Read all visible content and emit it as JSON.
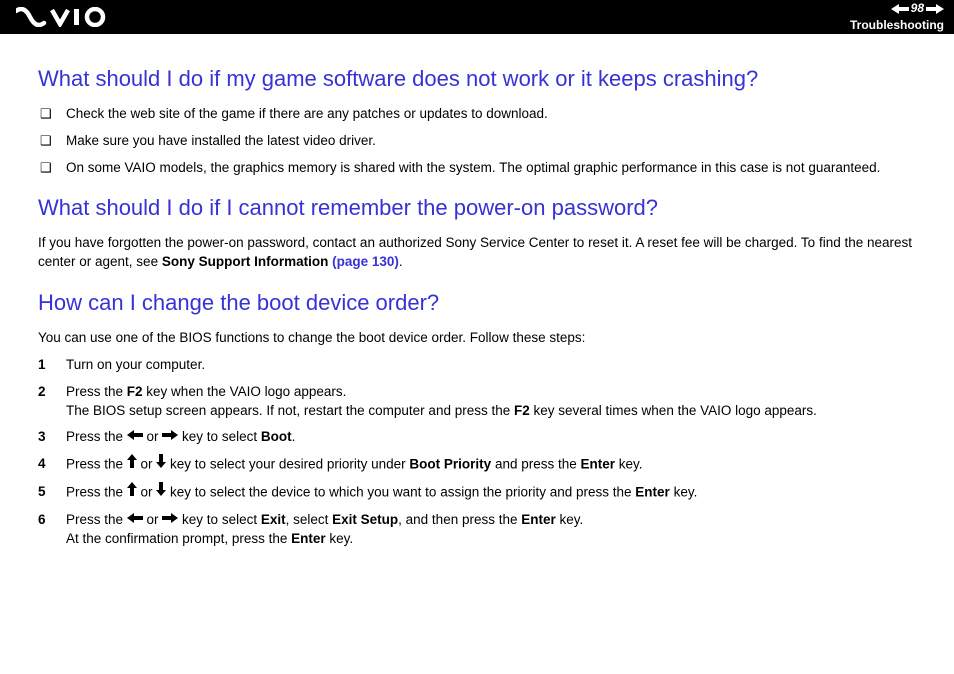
{
  "header": {
    "page_number": "98",
    "section": "Troubleshooting"
  },
  "q1": {
    "title": "What should I do if my game software does not work or it keeps crashing?",
    "bullets": [
      "Check the web site of the game if there are any patches or updates to download.",
      "Make sure you have installed the latest video driver.",
      "On some VAIO models, the graphics memory is shared with the system. The optimal graphic performance in this case is not guaranteed."
    ]
  },
  "q2": {
    "title": "What should I do if I cannot remember the power-on password?",
    "body_pre": "If you have forgotten the power-on password, contact an authorized Sony Service Center to reset it. A reset fee will be charged. To find the nearest center or agent, see ",
    "body_bold": "Sony Support Information ",
    "body_link": "(page 130)",
    "body_post": "."
  },
  "q3": {
    "title": "How can I change the boot device order?",
    "intro": "You can use one of the BIOS functions to change the boot device order. Follow these steps:",
    "steps": {
      "s1": {
        "num": "1",
        "text": "Turn on your computer."
      },
      "s2": {
        "num": "2",
        "pre": "Press the ",
        "key": "F2",
        "mid": " key when the VAIO logo appears.",
        "line2_pre": "The BIOS setup screen appears. If not, restart the computer and press the ",
        "line2_key": "F2",
        "line2_post": " key several times when the VAIO logo appears."
      },
      "s3": {
        "num": "3",
        "pre": "Press the ",
        "or": " or ",
        "mid": " key to select ",
        "target": "Boot",
        "post": "."
      },
      "s4": {
        "num": "4",
        "pre": "Press the ",
        "or": " or ",
        "mid": " key to select your desired priority under ",
        "target": "Boot Priority",
        "mid2": " and press the ",
        "key": "Enter",
        "post": " key."
      },
      "s5": {
        "num": "5",
        "pre": "Press the ",
        "or": " or ",
        "mid": " key to select the device to which you want to assign the priority and press the ",
        "key": "Enter",
        "post": " key."
      },
      "s6": {
        "num": "6",
        "pre": "Press the ",
        "or": " or ",
        "mid": " key to select ",
        "t1": "Exit",
        "mid2": ", select ",
        "t2": "Exit Setup",
        "mid3": ", and then press the ",
        "key": "Enter",
        "post": " key.",
        "line2_pre": "At the confirmation prompt, press the ",
        "line2_key": "Enter",
        "line2_post": " key."
      }
    }
  }
}
